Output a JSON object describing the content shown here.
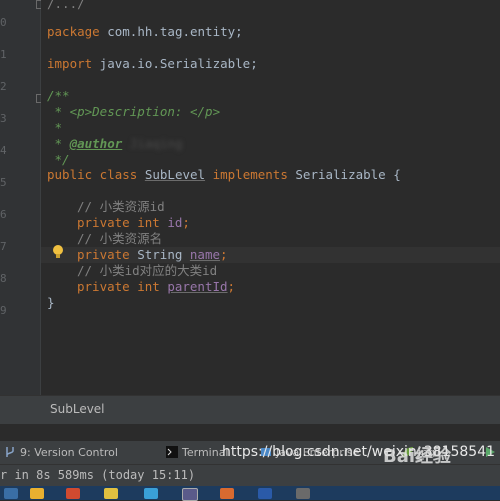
{
  "editor": {
    "lines": {
      "l1": "/.../",
      "l2_kw": "package",
      "l2_rest": " com.hh.tag.entity;",
      "l3_kw": "import",
      "l3_rest": " java.io.Serializable;",
      "l4": "/**",
      "l5_star": " * ",
      "l5_doc": "<p>Description: </p>",
      "l6": " *",
      "l7_star": " * ",
      "l7_tag": "@author",
      "l7_name": "Jiaqing",
      "l8": " */",
      "l9_kw1": "public class",
      "l9_cls": "SubLevel",
      "l9_kw2": "implements",
      "l9_rest": "Serializable {",
      "c1": "// 小类资源id",
      "f1_kw": "private int",
      "f1_name": "id",
      "c2": "// 小类资源名",
      "f2_kw": "private",
      "f2_type": "String",
      "f2_name": "name",
      "c3": "// 小类id对应的大类id",
      "f3_kw": "private int",
      "f3_name": "parentId",
      "end": "}"
    }
  },
  "breadcrumb": {
    "label": "SubLevel"
  },
  "toolbar": {
    "version_control": "9: Version Control",
    "terminal": "Terminal",
    "java_enterprise": "Java Enterprise",
    "logging": "ing"
  },
  "status": {
    "message": "r in 8s 589ms (today 15:11)"
  },
  "watermark": {
    "url": "https://blog.csdn.net/weixin_38158541",
    "baidu": "Bai经验"
  },
  "colors": {
    "background": "#2b2b2b",
    "keyword": "#cc7832",
    "comment": "#808080",
    "doc": "#629755",
    "field": "#9876aa"
  }
}
